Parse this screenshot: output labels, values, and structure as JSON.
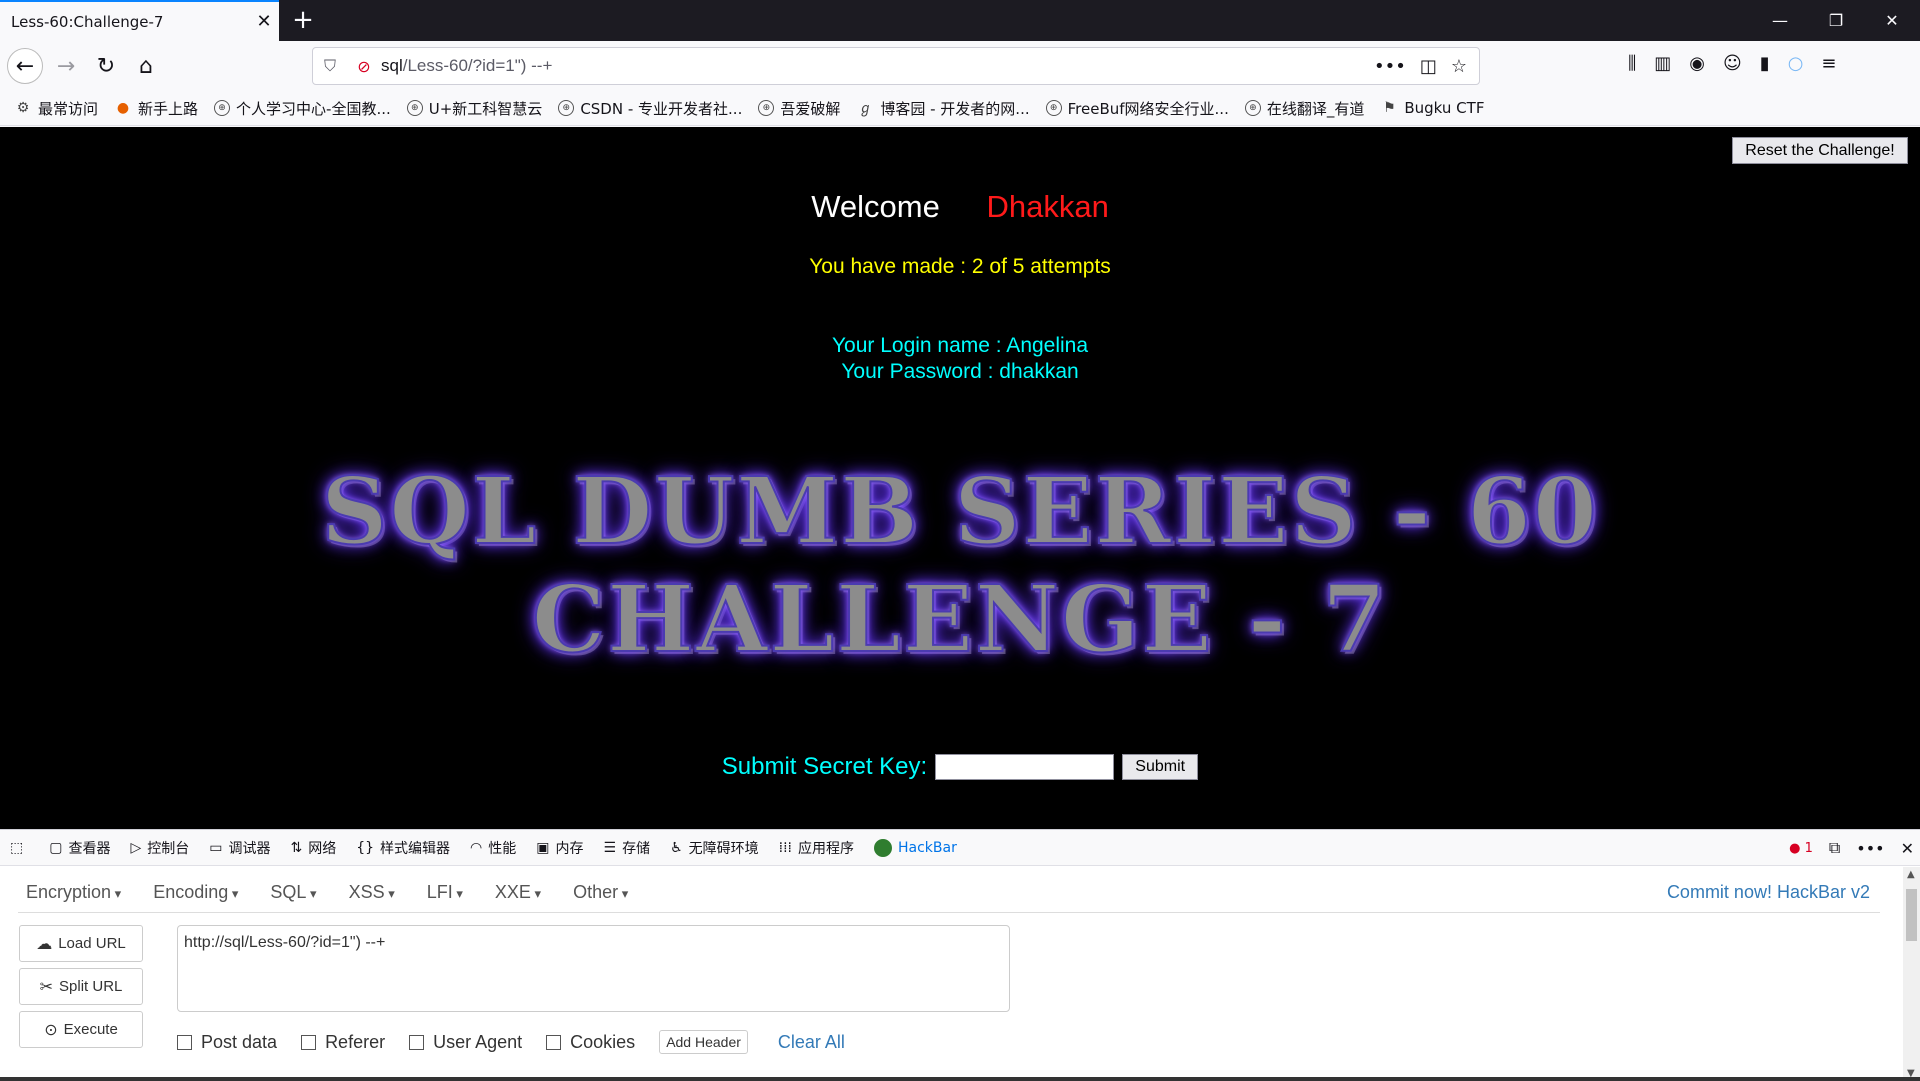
{
  "browser": {
    "tab_title": "Less-60:Challenge-7",
    "tab_close": "✕",
    "new_tab": "+",
    "url_host": "sql",
    "url_path": "/Less-60/?id=1\") --+",
    "window_controls": [
      "—",
      "❐",
      "✕"
    ]
  },
  "bookmarks": [
    {
      "label": "最常访问",
      "icon": "gear-icon"
    },
    {
      "label": "新手上路",
      "icon": "firefox-icon"
    },
    {
      "label": "个人学习中心-全国教...",
      "icon": "globe-icon"
    },
    {
      "label": "U+新工科智慧云",
      "icon": "globe-icon"
    },
    {
      "label": "CSDN - 专业开发者社...",
      "icon": "globe-icon"
    },
    {
      "label": "吾爱破解",
      "icon": "globe-icon"
    },
    {
      "label": "博客园 - 开发者的网...",
      "icon": "cnblogs-icon"
    },
    {
      "label": "FreeBuf网络安全行业...",
      "icon": "globe-icon"
    },
    {
      "label": "在线翻译_有道",
      "icon": "globe-icon"
    },
    {
      "label": "Bugku CTF",
      "icon": "flag-icon"
    }
  ],
  "page": {
    "reset_button": "Reset the Challenge!",
    "welcome_label": "Welcome",
    "welcome_user": "Dhakkan",
    "attempts": "You have made : 2 of 5 attempts",
    "login_name": "Your Login name : Angelina",
    "password": "Your Password : dhakkan",
    "banner_line1": "SQL DUMB SERIES - 60",
    "banner_line2": "CHALLENGE - 7",
    "secret_label": "Submit Secret Key:",
    "submit_button": "Submit"
  },
  "devtools": {
    "tabs": [
      {
        "label": "查看器",
        "icon": "▢"
      },
      {
        "label": "控制台",
        "icon": "▷"
      },
      {
        "label": "调试器",
        "icon": "▭"
      },
      {
        "label": "网络",
        "icon": "⇅"
      },
      {
        "label": "样式编辑器",
        "icon": "{}"
      },
      {
        "label": "性能",
        "icon": "◠"
      },
      {
        "label": "内存",
        "icon": "▣"
      },
      {
        "label": "存储",
        "icon": "☰"
      },
      {
        "label": "无障碍环境",
        "icon": "♿"
      },
      {
        "label": "应用程序",
        "icon": "⁞⁞⁞"
      }
    ],
    "active_tab": "HackBar",
    "error_count": "1"
  },
  "hackbar": {
    "menus": [
      "Encryption",
      "Encoding",
      "SQL",
      "XSS",
      "LFI",
      "XXE",
      "Other"
    ],
    "commit": "Commit now! HackBar v2",
    "load_url": "Load URL",
    "split_url": "Split URL",
    "execute": "Execute",
    "url_value": "http://sql/Less-60/?id=1\") --+",
    "post_data": "Post data",
    "referer": "Referer",
    "user_agent": "User Agent",
    "cookies": "Cookies",
    "add_header": "Add Header",
    "clear_all": "Clear All"
  }
}
